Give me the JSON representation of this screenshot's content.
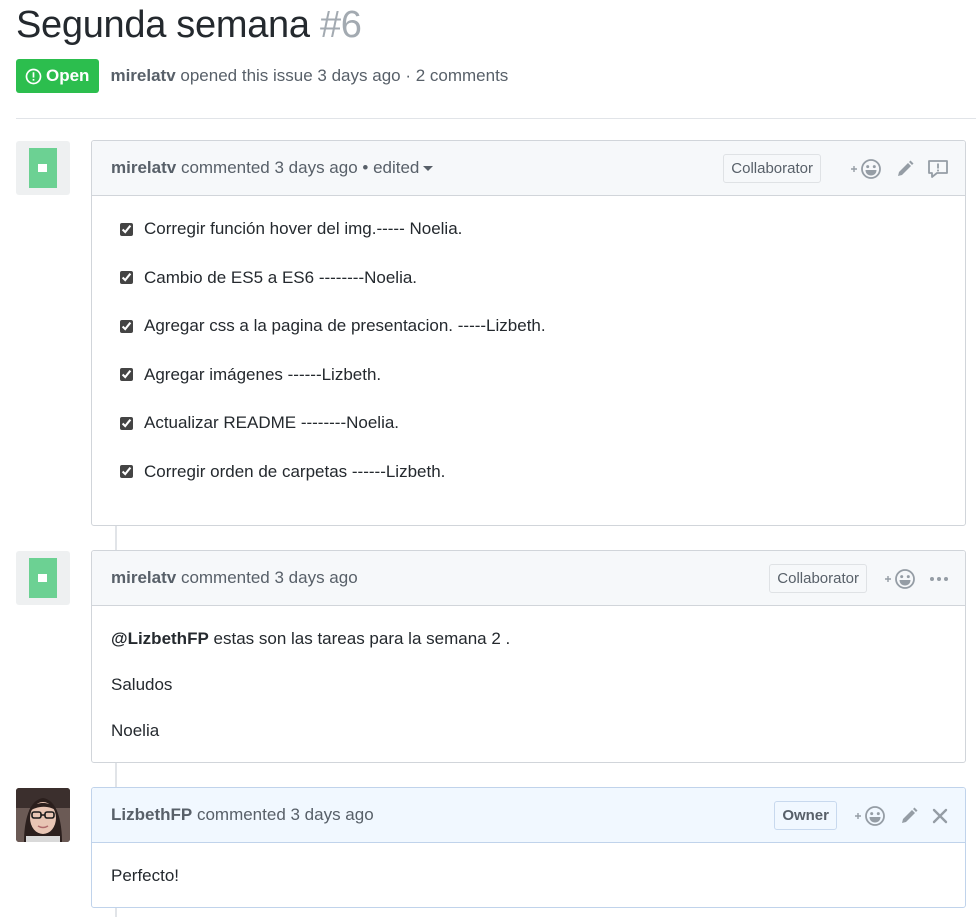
{
  "issue": {
    "title": "Segunda semana",
    "number": "#6",
    "state": "Open",
    "author": "mirelatv",
    "opened_text": "opened this issue 3 days ago · 2 comments"
  },
  "comments": [
    {
      "author": "mirelatv",
      "action": "commented 3 days ago",
      "edited": "• edited",
      "role": "Collaborator",
      "tasks": [
        "Corregir función hover del img.----- Noelia.",
        "Cambio de ES5 a ES6 --------Noelia.",
        "Agregar css a la pagina de presentacion. -----Lizbeth.",
        "Agregar imágenes ------Lizbeth.",
        "Actualizar README --------Noelia.",
        "Corregir orden de carpetas ------Lizbeth."
      ]
    },
    {
      "author": "mirelatv",
      "action": "commented 3 days ago",
      "role": "Collaborator",
      "mention": "@LizbethFP",
      "line1_rest": " estas son las tareas para la semana 2 .",
      "line2": "Saludos",
      "line3": "Noelia"
    },
    {
      "author": "LizbethFP",
      "action": "commented 3 days ago",
      "role": "Owner",
      "body": "Perfecto!"
    }
  ],
  "icons": {
    "state": "issue-opened-icon",
    "reaction": "smiley-icon",
    "edit": "pencil-icon",
    "report": "report-icon",
    "more": "kebab-icon",
    "delete": "close-icon"
  },
  "colors": {
    "open_green": "#2cbe4e",
    "identicon": "#6cd193",
    "owner_header_bg": "#f1f8ff"
  }
}
